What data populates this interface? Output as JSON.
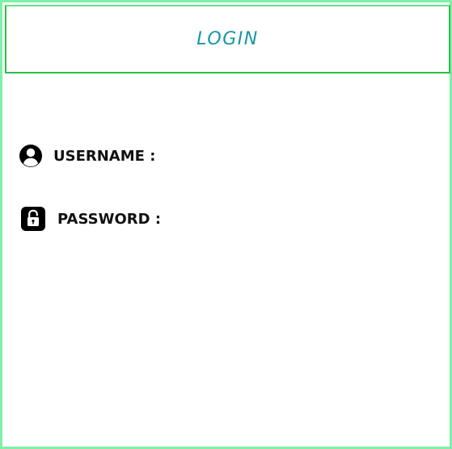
{
  "header": {
    "title": "LOGIN"
  },
  "form": {
    "username_label": "USERNAME :",
    "password_label": "PASSWORD :"
  },
  "icons": {
    "username": "user-circle-icon",
    "password": "lock-icon"
  },
  "colors": {
    "frame_border": "#7ef0a8",
    "header_border": "#2dbf4a",
    "title": "#1597a3",
    "label": "#111111"
  }
}
